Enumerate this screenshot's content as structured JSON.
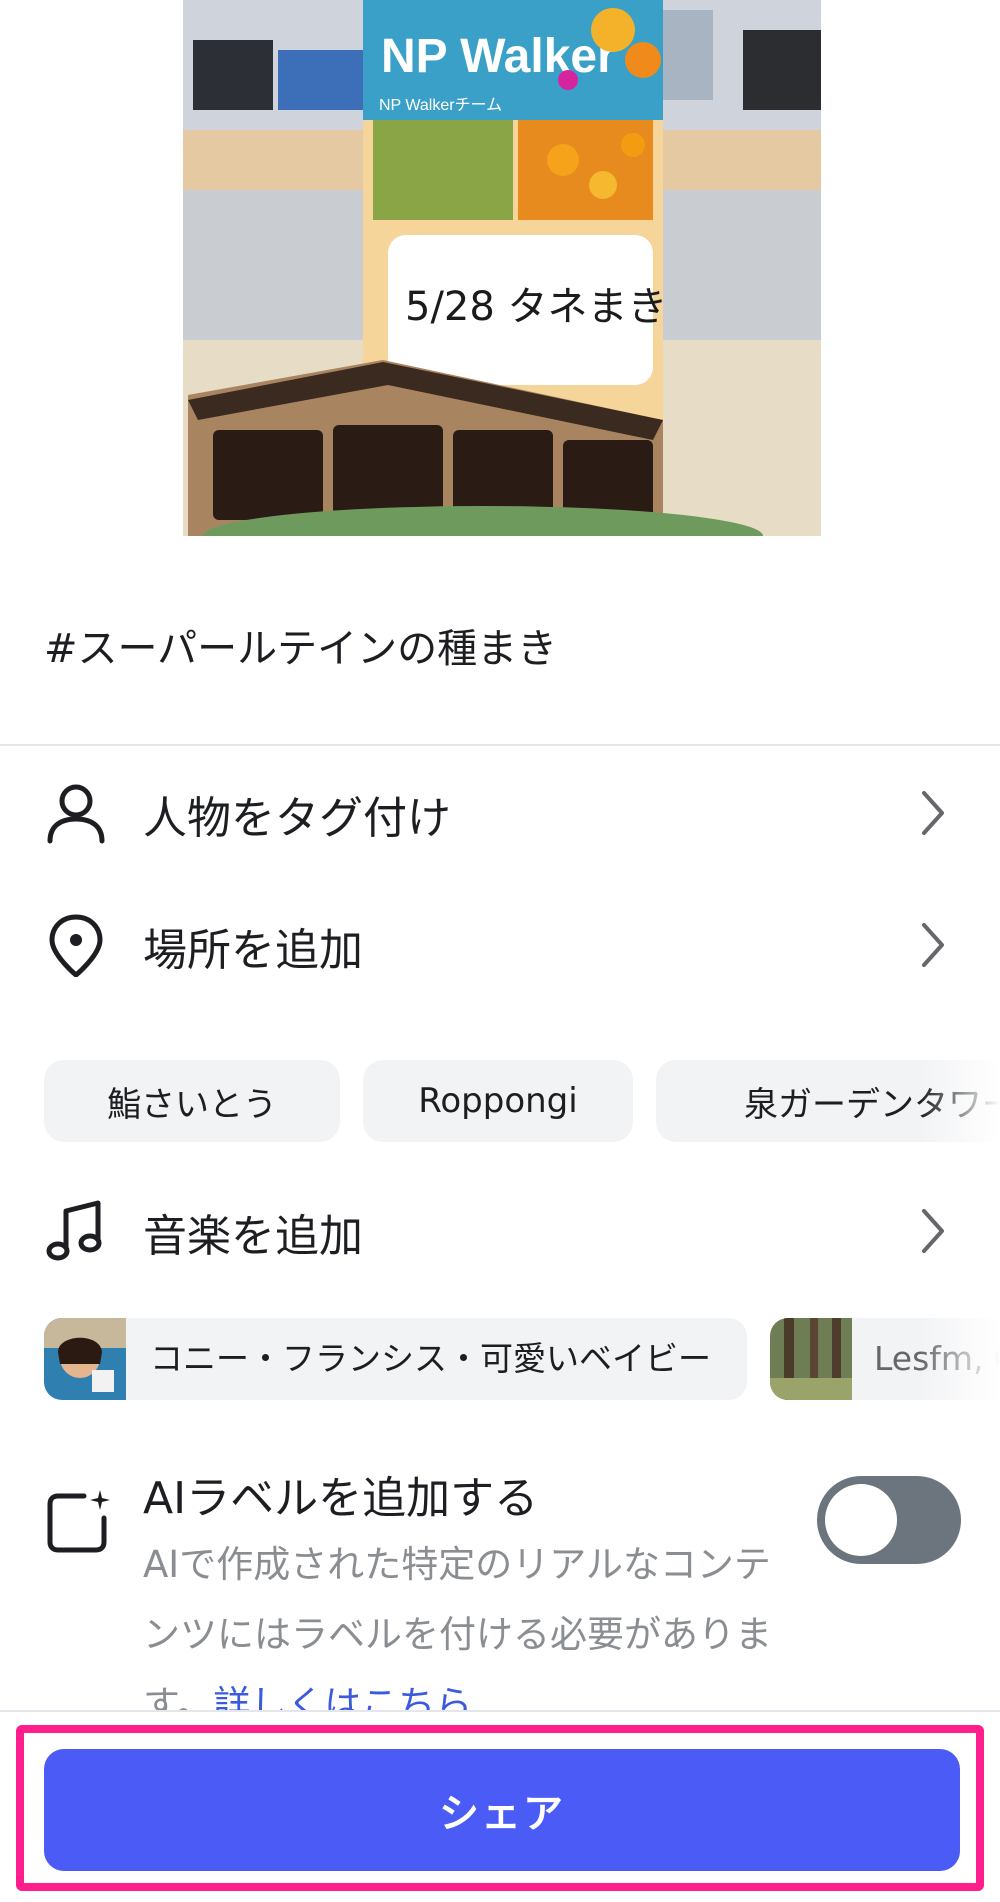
{
  "caption": "#スーパールテインの種まき",
  "rows": {
    "tag_people": "人物をタグ付け",
    "add_location": "場所を追加",
    "add_music": "音楽を追加"
  },
  "location_suggestions": [
    "鮨さいとう",
    "Roppongi",
    "泉ガーデンタワー"
  ],
  "music_suggestions": [
    {
      "title": "コニー・フランシス・可愛いベイビー",
      "thumb": "album-cover"
    },
    {
      "title": "Lesfm, C",
      "thumb": "forest-cover"
    }
  ],
  "ai_label": {
    "title": "AIラベルを追加する",
    "description": "AIで作成された特定のリアルなコンテンツにはラベルを付ける必要があります。",
    "link": "詳しくはこちら",
    "enabled": false
  },
  "photo": {
    "poster_title": "NP Walker",
    "poster_team": "NP Walkerチーム",
    "handwritten": "5/28 タネまき"
  },
  "share_button": "シェア",
  "colors": {
    "primary": "#4a5cf5",
    "highlight": "#ff1e8c",
    "toggle_off": "#6c757d",
    "link": "#3b5bdb"
  }
}
